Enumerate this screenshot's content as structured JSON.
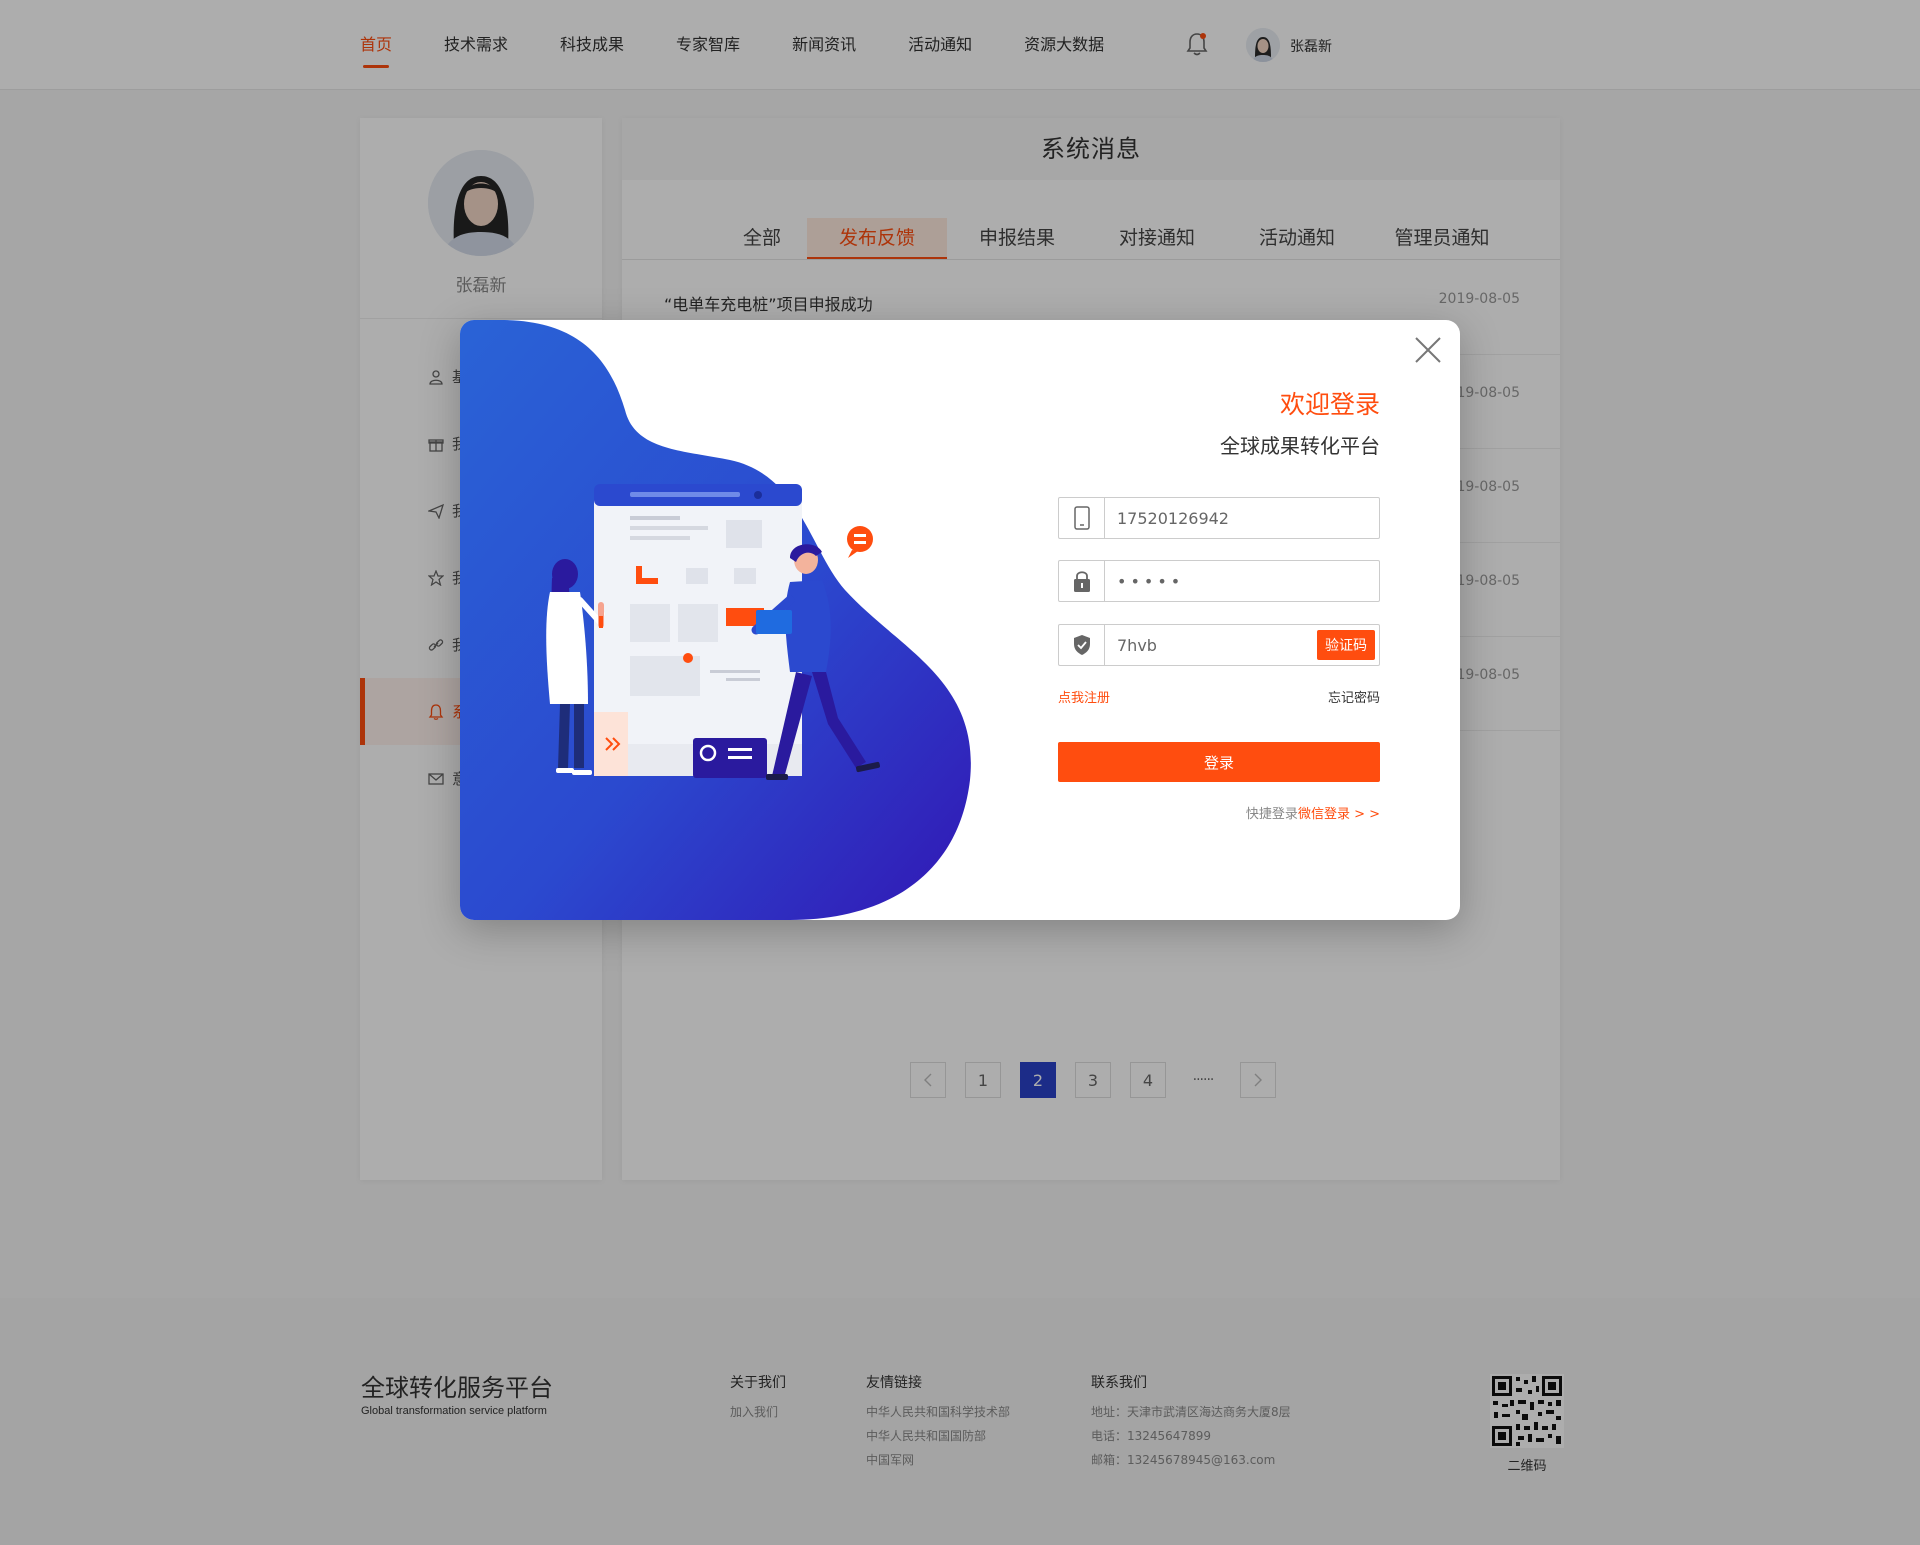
{
  "nav": {
    "items": [
      {
        "label": "首页",
        "active": true
      },
      {
        "label": "技术需求"
      },
      {
        "label": "科技成果"
      },
      {
        "label": "专家智库"
      },
      {
        "label": "新闻资讯"
      },
      {
        "label": "活动通知"
      },
      {
        "label": "资源大数据"
      }
    ],
    "user_name": "张磊新",
    "bell_icon": "bell-icon"
  },
  "sidebar": {
    "name": "张磊新",
    "items": [
      {
        "label": "基",
        "icon": "user-icon"
      },
      {
        "label": "我",
        "icon": "gift-icon"
      },
      {
        "label": "我",
        "icon": "send-icon"
      },
      {
        "label": "我",
        "icon": "star-icon"
      },
      {
        "label": "我",
        "icon": "link-icon"
      },
      {
        "label": "系",
        "icon": "bell-icon",
        "active": true
      },
      {
        "label": "意",
        "icon": "mail-icon"
      }
    ]
  },
  "main": {
    "title": "系统消息",
    "tabs": [
      "全部",
      "发布反馈",
      "申报结果",
      "对接通知",
      "活动通知",
      "管理员通知"
    ],
    "active_tab": 1,
    "messages": [
      {
        "title": "“电单车充电桩”项目申报成功",
        "date": "2019-08-05"
      },
      {
        "title": "",
        "date": "19-08-05"
      },
      {
        "title": "",
        "date": "19-08-05"
      },
      {
        "title": "",
        "date": "19-08-05"
      },
      {
        "title": "",
        "date": "19-08-05"
      }
    ],
    "pagination": {
      "pages": [
        "1",
        "2",
        "3",
        "4"
      ],
      "current": "2",
      "ellipsis": "······"
    }
  },
  "footer": {
    "brand": "全球转化服务平台",
    "brand_en": "Global transformation service platform",
    "about": {
      "title": "关于我们",
      "items": [
        "加入我们"
      ]
    },
    "links": {
      "title": "友情链接",
      "items": [
        "中华人民共和国科学技术部",
        "中华人民共和国国防部",
        "中国军网"
      ]
    },
    "contact": {
      "title": "联系我们",
      "items": [
        "地址：天津市武清区海达商务大厦8层",
        "电话：13245647899",
        "邮箱：13245678945@163.com"
      ]
    },
    "qr_label": "二维码"
  },
  "modal": {
    "welcome": "欢迎登录",
    "subtitle": "全球成果转化平台",
    "phone_value": "17520126942",
    "password_value": "•••••",
    "code_value": "7hvb",
    "code_button": "验证码",
    "register_link": "点我注册",
    "forgot_link": "忘记密码",
    "login_button": "登录",
    "quick_prefix": "快捷登录",
    "quick_wechat": "微信登录 > >",
    "colors": {
      "accent": "#ff4d0f",
      "blue": "#2a41c9"
    }
  }
}
